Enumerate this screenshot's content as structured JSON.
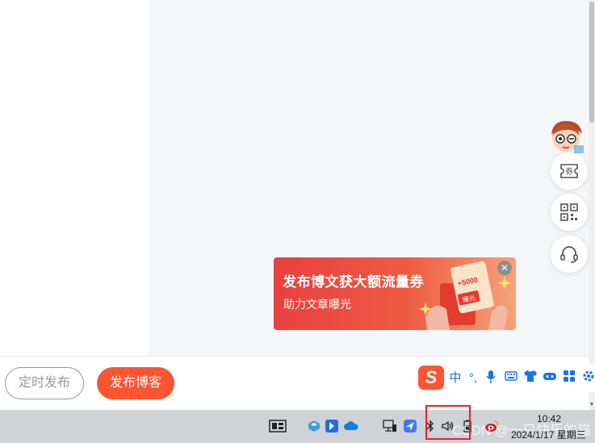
{
  "bottom_actions": {
    "schedule_label": "定时发布",
    "publish_label": "发布博客"
  },
  "promo": {
    "title": "发布博文获大额流量券",
    "subtitle": "助力文章曝光",
    "coupon_amount": "+5000",
    "coupon_text": "曝光",
    "close_icon": "close-icon"
  },
  "side_tools": {
    "coupon_label": "券",
    "qr_icon": "qr-code-icon",
    "support_icon": "headset-icon"
  },
  "ime": {
    "logo": "S",
    "mode": "中",
    "items": [
      "punctuation-icon",
      "microphone-icon",
      "keyboard-icon",
      "skin-icon",
      "game-icon",
      "apps-icon",
      "settings-icon"
    ]
  },
  "taskbar": {
    "time": "10:42",
    "date": "2024/1/17 星期三",
    "watermark": "CSDN @一只快乐的猫"
  },
  "colors": {
    "accent": "#fc5531",
    "ime_blue": "#1a73e8",
    "highlight_box": "#e5222c"
  }
}
